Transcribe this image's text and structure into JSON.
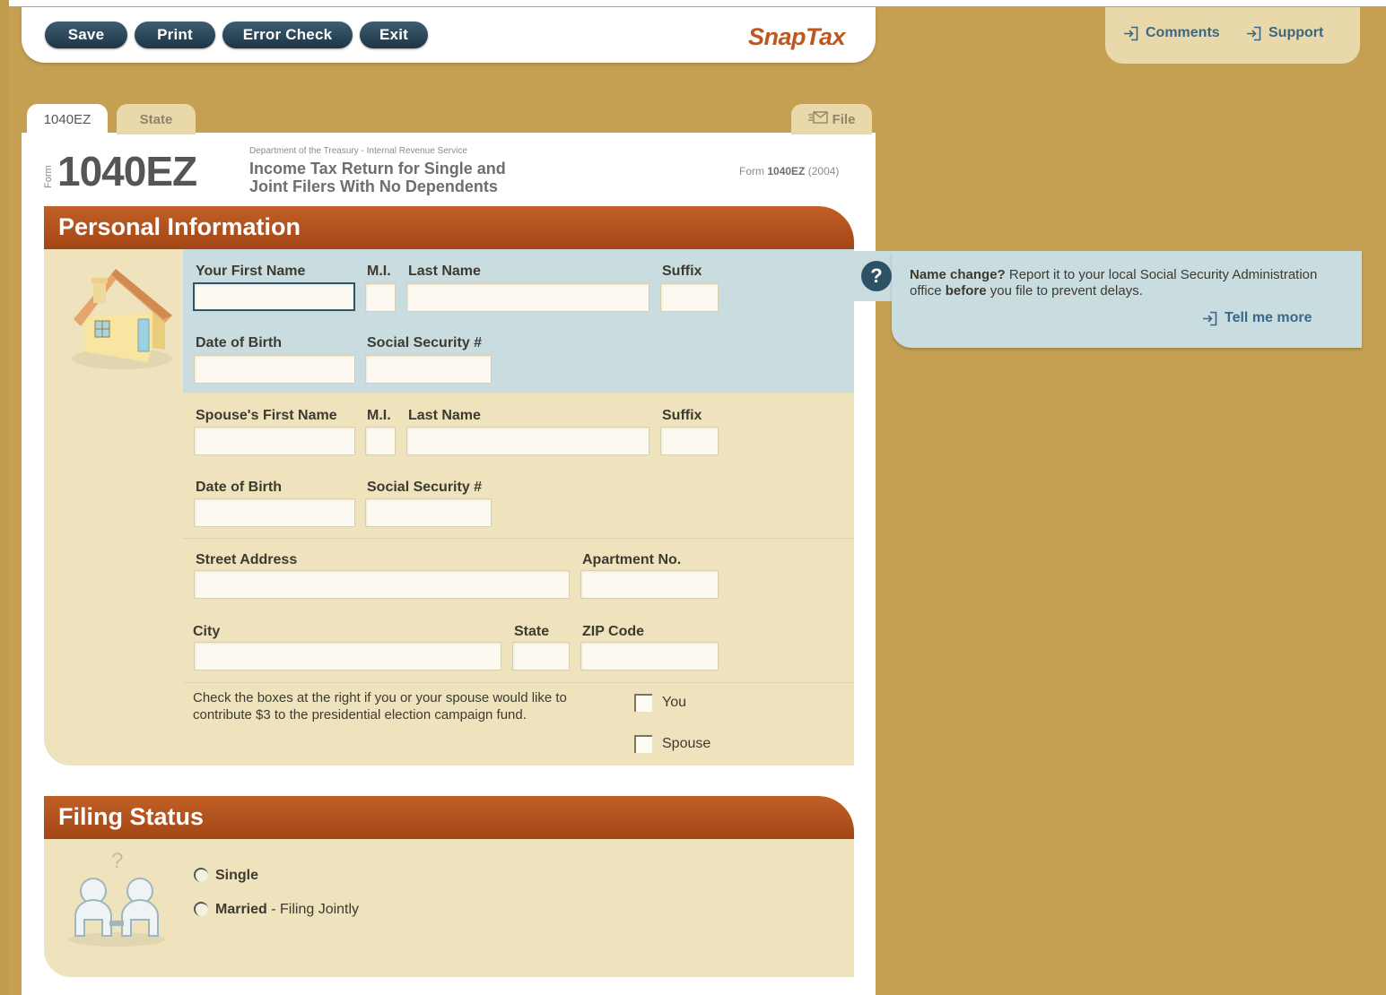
{
  "toolbar": {
    "buttons": [
      "Save",
      "Print",
      "Error Check",
      "Exit"
    ],
    "brand": "SnapTax"
  },
  "top_links": {
    "comments": "Comments",
    "support": "Support"
  },
  "tabs": {
    "active": "1040EZ",
    "state": "State",
    "file": "File"
  },
  "form_header": {
    "form_word": "Form",
    "number": "1040EZ",
    "dept": "Department of the Treasury - Internal Revenue Service",
    "title": "Income Tax Return for Single and Joint Filers With No Dependents",
    "year_prefix": "Form",
    "year_form": "1040EZ",
    "year": "(2004)"
  },
  "personal": {
    "title": "Personal Information",
    "first_name": "Your First Name",
    "mi": "M.I.",
    "last_name": "Last Name",
    "suffix": "Suffix",
    "dob": "Date of Birth",
    "ssn": "Social Security #",
    "spouse_first": "Spouse's First Name",
    "spouse_mi": "M.I.",
    "spouse_last": "Last Name",
    "spouse_suffix": "Suffix",
    "spouse_dob": "Date of Birth",
    "spouse_ssn": "Social Security #",
    "street": "Street Address",
    "apt": "Apartment No.",
    "city": "City",
    "state": "State",
    "zip": "ZIP Code",
    "campaign_note": "Check the boxes at the right if you or your spouse would like to contribute $3 to the presidential election campaign fund.",
    "you": "You",
    "spouse": "Spouse"
  },
  "filing": {
    "title": "Filing Status",
    "single": "Single",
    "married": "Married",
    "married_suffix": " - Filing Jointly"
  },
  "tip": {
    "lead": "Name change?",
    "text1": " Report it to your local Social Security Administration office ",
    "bold": "before",
    "text2": " you file to prevent delays.",
    "link": "Tell me more"
  },
  "colors": {
    "background": "#c6a052",
    "section_header": "#b04f1c",
    "button": "#2a4658",
    "brand": "#c0551d",
    "link": "#3a6786",
    "highlight": "#c9dde0"
  }
}
